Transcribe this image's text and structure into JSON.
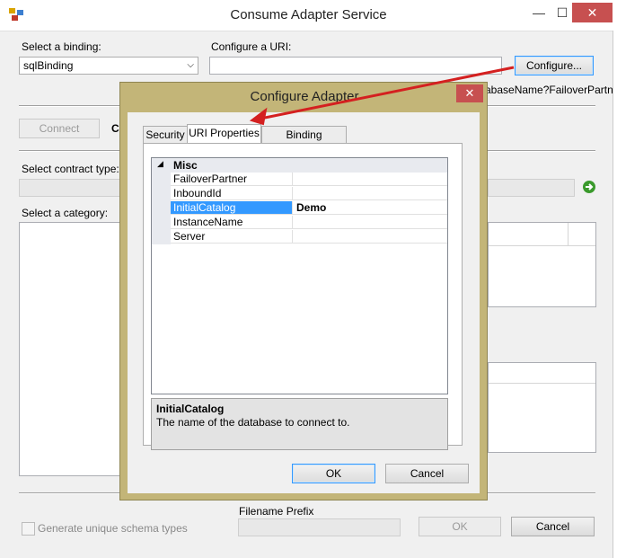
{
  "main_window": {
    "title": "Consume Adapter Service",
    "select_binding_label": "Select a binding:",
    "binding_value": "sqlBinding",
    "configure_uri_label": "Configure a URI:",
    "uri_value": "",
    "configure_button": "Configure...",
    "uri_hint_text": "abaseName?FailoverPartn",
    "connect_button": "Connect",
    "connect_status_fragment": "C",
    "select_contract_label": "Select contract type:",
    "select_category_label": "Select a category:",
    "filename_prefix_label": "Filename Prefix",
    "generate_unique_label": "Generate unique schema types",
    "ok_button": "OK",
    "cancel_button": "Cancel"
  },
  "dialog": {
    "title": "Configure Adapter",
    "tabs": [
      {
        "label": "Security",
        "active": false
      },
      {
        "label": "URI Properties",
        "active": true
      },
      {
        "label": "Binding Properties",
        "active": false
      }
    ],
    "grid": {
      "category": "Misc",
      "collapse_glyph": "◢",
      "rows": [
        {
          "name": "FailoverPartner",
          "value": ""
        },
        {
          "name": "InboundId",
          "value": ""
        },
        {
          "name": "InitialCatalog",
          "value": "Demo",
          "selected": true
        },
        {
          "name": "InstanceName",
          "value": ""
        },
        {
          "name": "Server",
          "value": ""
        }
      ]
    },
    "help": {
      "title": "InitialCatalog",
      "description": "The name of the database to connect to."
    },
    "ok_button": "OK",
    "cancel_button": "Cancel"
  },
  "colors": {
    "dialog_frame": "#c3b578",
    "selection": "#3399ff",
    "annotation_arrow": "#d42020",
    "close_button": "#c75050"
  }
}
